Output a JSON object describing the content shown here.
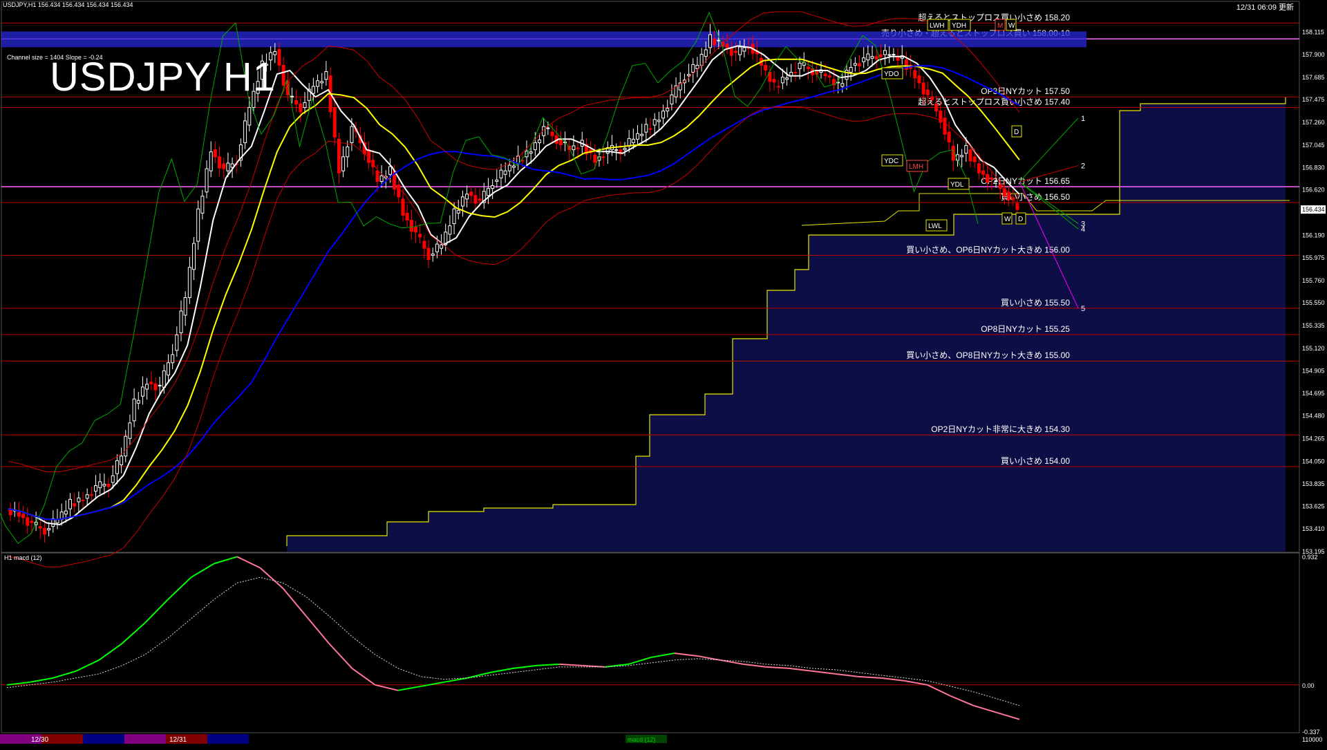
{
  "header": {
    "symbol_info": "USDJPY,H1  156.434 156.434 156.434 156.434",
    "clock": "12/31 06:09 更新",
    "title": "USDJPY H1",
    "channel_info": "Channel size = 1404 Slope = -0.24"
  },
  "colors": {
    "background": "#000000",
    "bull_candle": "#ffffff",
    "bear_candle": "#ff0000",
    "sma_fast": "#ffffff",
    "sma_mid": "#ffff00",
    "sma_slow": "#0000ff",
    "level_line": "#c00000",
    "pink_line": "#ff66ff",
    "macd_up": "#00ff00",
    "macd_down": "#ff7799"
  },
  "chart_data": [
    {
      "type": "candlestick",
      "title": "USDJPY H1",
      "ylim": [
        153.195,
        158.3
      ],
      "y_ticks": [
        "158.115",
        "157.900",
        "157.685",
        "157.475",
        "157.260",
        "157.045",
        "156.830",
        "156.620",
        "156.434",
        "156.190",
        "155.975",
        "155.760",
        "155.550",
        "155.335",
        "155.120",
        "154.905",
        "154.695",
        "154.480",
        "154.265",
        "154.050",
        "153.835",
        "153.625",
        "153.410",
        "153.195"
      ],
      "current_price": "156.434",
      "price_path": [
        153.6,
        153.55,
        153.45,
        153.4,
        153.5,
        153.65,
        153.7,
        153.8,
        153.85,
        154.1,
        154.6,
        154.8,
        154.75,
        155.1,
        155.6,
        156.4,
        157.0,
        156.8,
        156.9,
        157.4,
        157.8,
        157.95,
        157.5,
        157.4,
        157.6,
        157.7,
        156.8,
        157.2,
        157.0,
        156.7,
        156.8,
        156.4,
        156.2,
        156.0,
        156.1,
        156.4,
        156.6,
        156.5,
        156.7,
        156.8,
        156.9,
        157.0,
        157.2,
        157.1,
        157.0,
        157.05,
        156.9,
        157.0,
        157.0,
        157.1,
        157.2,
        157.3,
        157.5,
        157.7,
        157.8,
        158.05,
        158.0,
        157.9,
        158.0,
        157.8,
        157.6,
        157.7,
        157.8,
        157.75,
        157.7,
        157.6,
        157.8,
        157.85,
        157.9,
        157.9,
        157.85,
        157.7,
        157.5,
        157.3,
        156.9,
        157.0,
        156.8,
        156.7,
        156.6,
        156.434
      ],
      "levels": [
        {
          "label": "超えるとストップロス買い小さめ 158.20",
          "value": 158.2
        },
        {
          "label": "売り小さめ・超えるとストップロス買い 158.00-10",
          "value": 158.05
        },
        {
          "label": "OP3日NYカット 157.50",
          "value": 157.5
        },
        {
          "label": "超えるとストップロス買い小さめ 157.40",
          "value": 157.4
        },
        {
          "label": "OP2日NYカット 156.65",
          "value": 156.65
        },
        {
          "label": "買い小さめ 156.50",
          "value": 156.5
        },
        {
          "label": "買い小さめ、OP6日NYカット大きめ 156.00",
          "value": 156.0
        },
        {
          "label": "買い小さめ 155.50",
          "value": 155.5
        },
        {
          "label": "OP8日NYカット 155.25",
          "value": 155.25
        },
        {
          "label": "買い小さめ、OP8日NYカット大きめ 155.00",
          "value": 155.0
        },
        {
          "label": "OP2日NYカット非常に大きめ 154.30",
          "value": 154.3
        },
        {
          "label": "買い小さめ 154.00",
          "value": 154.0
        }
      ],
      "markers": [
        "LWH",
        "YDH",
        "M",
        "W",
        "YDO",
        "YDC",
        "LMH",
        "YDL",
        "LWL",
        "D",
        "W",
        "D"
      ],
      "projection_labels": [
        "1",
        "2",
        "3",
        "4",
        "5"
      ],
      "grid": false
    },
    {
      "type": "line",
      "title": "H1  macd (12)",
      "ylim": [
        -0.337,
        0.932
      ],
      "y_ticks": [
        "0.932",
        "0.00",
        "-0.337"
      ],
      "series": [
        {
          "name": "macd",
          "values": [
            0.0,
            0.02,
            0.05,
            0.1,
            0.18,
            0.3,
            0.45,
            0.62,
            0.78,
            0.88,
            0.93,
            0.85,
            0.7,
            0.5,
            0.3,
            0.12,
            0.0,
            -0.04,
            -0.01,
            0.02,
            0.05,
            0.09,
            0.12,
            0.14,
            0.15,
            0.14,
            0.13,
            0.15,
            0.2,
            0.23,
            0.21,
            0.18,
            0.15,
            0.13,
            0.12,
            0.1,
            0.08,
            0.06,
            0.05,
            0.03,
            0.0,
            -0.08,
            -0.15,
            -0.2,
            -0.25
          ]
        },
        {
          "name": "signal",
          "values": [
            -0.02,
            0.0,
            0.02,
            0.05,
            0.08,
            0.14,
            0.22,
            0.34,
            0.48,
            0.62,
            0.74,
            0.78,
            0.74,
            0.64,
            0.5,
            0.35,
            0.22,
            0.12,
            0.06,
            0.04,
            0.05,
            0.07,
            0.09,
            0.11,
            0.13,
            0.13,
            0.13,
            0.14,
            0.16,
            0.18,
            0.19,
            0.18,
            0.17,
            0.15,
            0.14,
            0.12,
            0.11,
            0.09,
            0.07,
            0.05,
            0.03,
            -0.01,
            -0.05,
            -0.1,
            -0.15
          ]
        }
      ]
    }
  ],
  "timebar": {
    "labels": [
      "12/30",
      "12/31"
    ],
    "indicator": "macd (12)",
    "right_value": "110000"
  }
}
